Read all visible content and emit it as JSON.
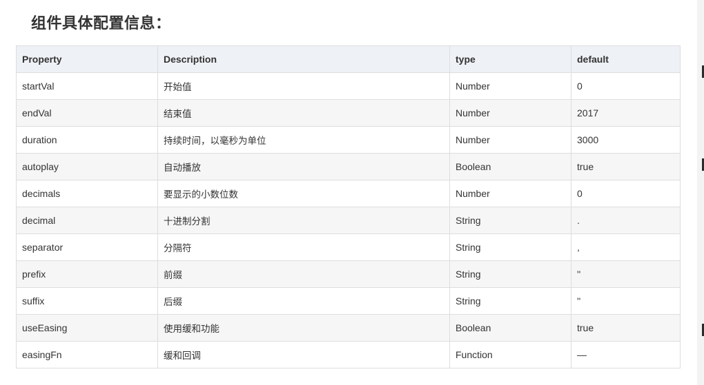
{
  "title": "组件具体配置信息：",
  "table": {
    "headers": [
      "Property",
      "Description",
      "type",
      "default"
    ],
    "rows": [
      [
        "startVal",
        "开始值",
        "Number",
        "0"
      ],
      [
        "endVal",
        "结束值",
        "Number",
        "2017"
      ],
      [
        "duration",
        "持续时间，以毫秒为单位",
        "Number",
        "3000"
      ],
      [
        "autoplay",
        "自动播放",
        "Boolean",
        "true"
      ],
      [
        "decimals",
        "要显示的小数位数",
        "Number",
        "0"
      ],
      [
        "decimal",
        "十进制分割",
        "String",
        "."
      ],
      [
        "separator",
        "分隔符",
        "String",
        ","
      ],
      [
        "prefix",
        "前缀",
        "String",
        "''"
      ],
      [
        "suffix",
        "后缀",
        "String",
        "''"
      ],
      [
        "useEasing",
        "使用缓和功能",
        "Boolean",
        "true"
      ],
      [
        "easingFn",
        "缓和回调",
        "Function",
        "—"
      ]
    ]
  }
}
